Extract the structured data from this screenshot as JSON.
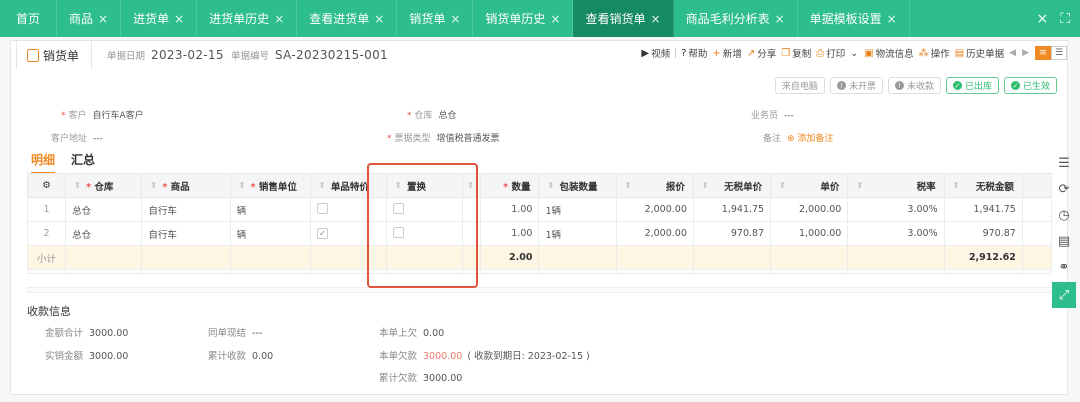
{
  "tabs": [
    {
      "label": "首页",
      "closable": false
    },
    {
      "label": "商品",
      "closable": true
    },
    {
      "label": "进货单",
      "closable": true
    },
    {
      "label": "进货单历史",
      "closable": true
    },
    {
      "label": "查看进货单",
      "closable": true
    },
    {
      "label": "销货单",
      "closable": true
    },
    {
      "label": "销货单历史",
      "closable": true
    },
    {
      "label": "查看销货单",
      "closable": true,
      "active": true
    },
    {
      "label": "商品毛利分析表",
      "closable": true
    },
    {
      "label": "单据模板设置",
      "closable": true
    }
  ],
  "tab_close": "×",
  "window_controls": {
    "close": "×",
    "expand": "⛶"
  },
  "doc": {
    "title": "销货单",
    "date_label": "单据日期",
    "date": "2023-02-15",
    "no_label": "单据编号",
    "no": "SA-20230215-001"
  },
  "toolbar": [
    {
      "icon": "▶",
      "label": "视频"
    },
    {
      "icon": "?",
      "label": "帮助"
    },
    {
      "icon": "+",
      "label": "新增"
    },
    {
      "icon": "↗",
      "label": "分享"
    },
    {
      "icon": "❐",
      "label": "复制"
    },
    {
      "icon": "⎙",
      "label": "打印"
    },
    {
      "icon": "▣",
      "label": "物流信息"
    },
    {
      "icon": "⁂",
      "label": "操作"
    },
    {
      "icon": "▤",
      "label": "历史单据"
    }
  ],
  "badges": [
    {
      "label": "来自电脑",
      "type": "plain",
      "icon": ""
    },
    {
      "label": "未开票",
      "type": "gray",
      "icon": "!"
    },
    {
      "label": "未收款",
      "type": "gray",
      "icon": "!"
    },
    {
      "label": "已出库",
      "type": "green",
      "icon": "✓"
    },
    {
      "label": "已生效",
      "type": "green",
      "icon": "✓"
    }
  ],
  "fields": {
    "customer_label": "客户",
    "customer": "自行车A客户",
    "warehouse_label": "仓库",
    "warehouse": "总仓",
    "salesman_label": "业务员",
    "salesman": "---",
    "address_label": "客户地址",
    "address": "---",
    "invoice_label": "票据类型",
    "invoice": "增值税普通发票",
    "note_label": "备注",
    "note_action": "添加备注"
  },
  "subtabs": [
    "明细",
    "汇总"
  ],
  "table": {
    "headers": [
      "仓库",
      "商品",
      "销售单位",
      "单品特价",
      "置换",
      "数量",
      "包装数量",
      "报价",
      "无税单价",
      "单价",
      "税率",
      "无税金额"
    ],
    "rows": [
      {
        "idx": "1",
        "warehouse": "总仓",
        "product": "自行车",
        "unit": "辆",
        "special": false,
        "swap": false,
        "qty": "1.00",
        "pack": "1辆",
        "quote": "2,000.00",
        "net_price": "1,941.75",
        "price": "2,000.00",
        "tax": "3.00%",
        "net_amount": "1,941.75"
      },
      {
        "idx": "2",
        "warehouse": "总仓",
        "product": "自行车",
        "unit": "辆",
        "special": true,
        "swap": false,
        "qty": "1.00",
        "pack": "1辆",
        "quote": "2,000.00",
        "net_price": "970.87",
        "price": "1,000.00",
        "tax": "3.00%",
        "net_amount": "970.87"
      }
    ],
    "subtotal": {
      "label": "小计",
      "qty": "2.00",
      "net_amount": "2,912.62"
    }
  },
  "payment": {
    "title": "收款信息",
    "total_label": "金额合计",
    "total": "3000.00",
    "actual_label": "实销金额",
    "actual": "3000.00",
    "cash_label": "同单现结",
    "cash": "---",
    "cumrecv_label": "累计收款",
    "cumrecv": "0.00",
    "prev_label": "本单上欠",
    "prev": "0.00",
    "owe_label": "本单欠款",
    "owe": "3000.00",
    "owe_note": "( 收款到期日: 2023-02-15 )",
    "cumowe_label": "累计欠款",
    "cumowe": "3000.00"
  },
  "colors": {
    "tabbar": "#2ebd8e",
    "tab_active": "#168a63",
    "accent": "#f08a24",
    "highlight": "#e0533c"
  }
}
